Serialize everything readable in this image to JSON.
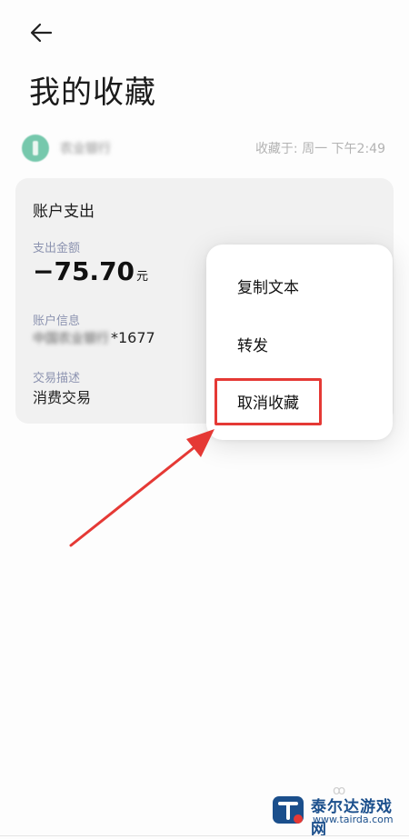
{
  "header": {
    "title": "我的收藏"
  },
  "source": {
    "name": "农业银行",
    "saved_time": "收藏于: 周一 下午2:49"
  },
  "card": {
    "title": "账户支出",
    "amount_label": "支出金额",
    "amount": "−75.70",
    "amount_unit": "元",
    "account_label": "账户信息",
    "account_name_blurred": "中国农业银行",
    "account_suffix": "*1677",
    "desc_label": "交易描述",
    "desc_value": "消费交易"
  },
  "menu": {
    "items": [
      "复制文本",
      "转发",
      "取消收藏"
    ]
  },
  "watermark": {
    "name": "泰尔达游戏网",
    "url": "www.tairda.com"
  },
  "colors": {
    "highlight": "#e53935",
    "label": "#8c93b0"
  }
}
